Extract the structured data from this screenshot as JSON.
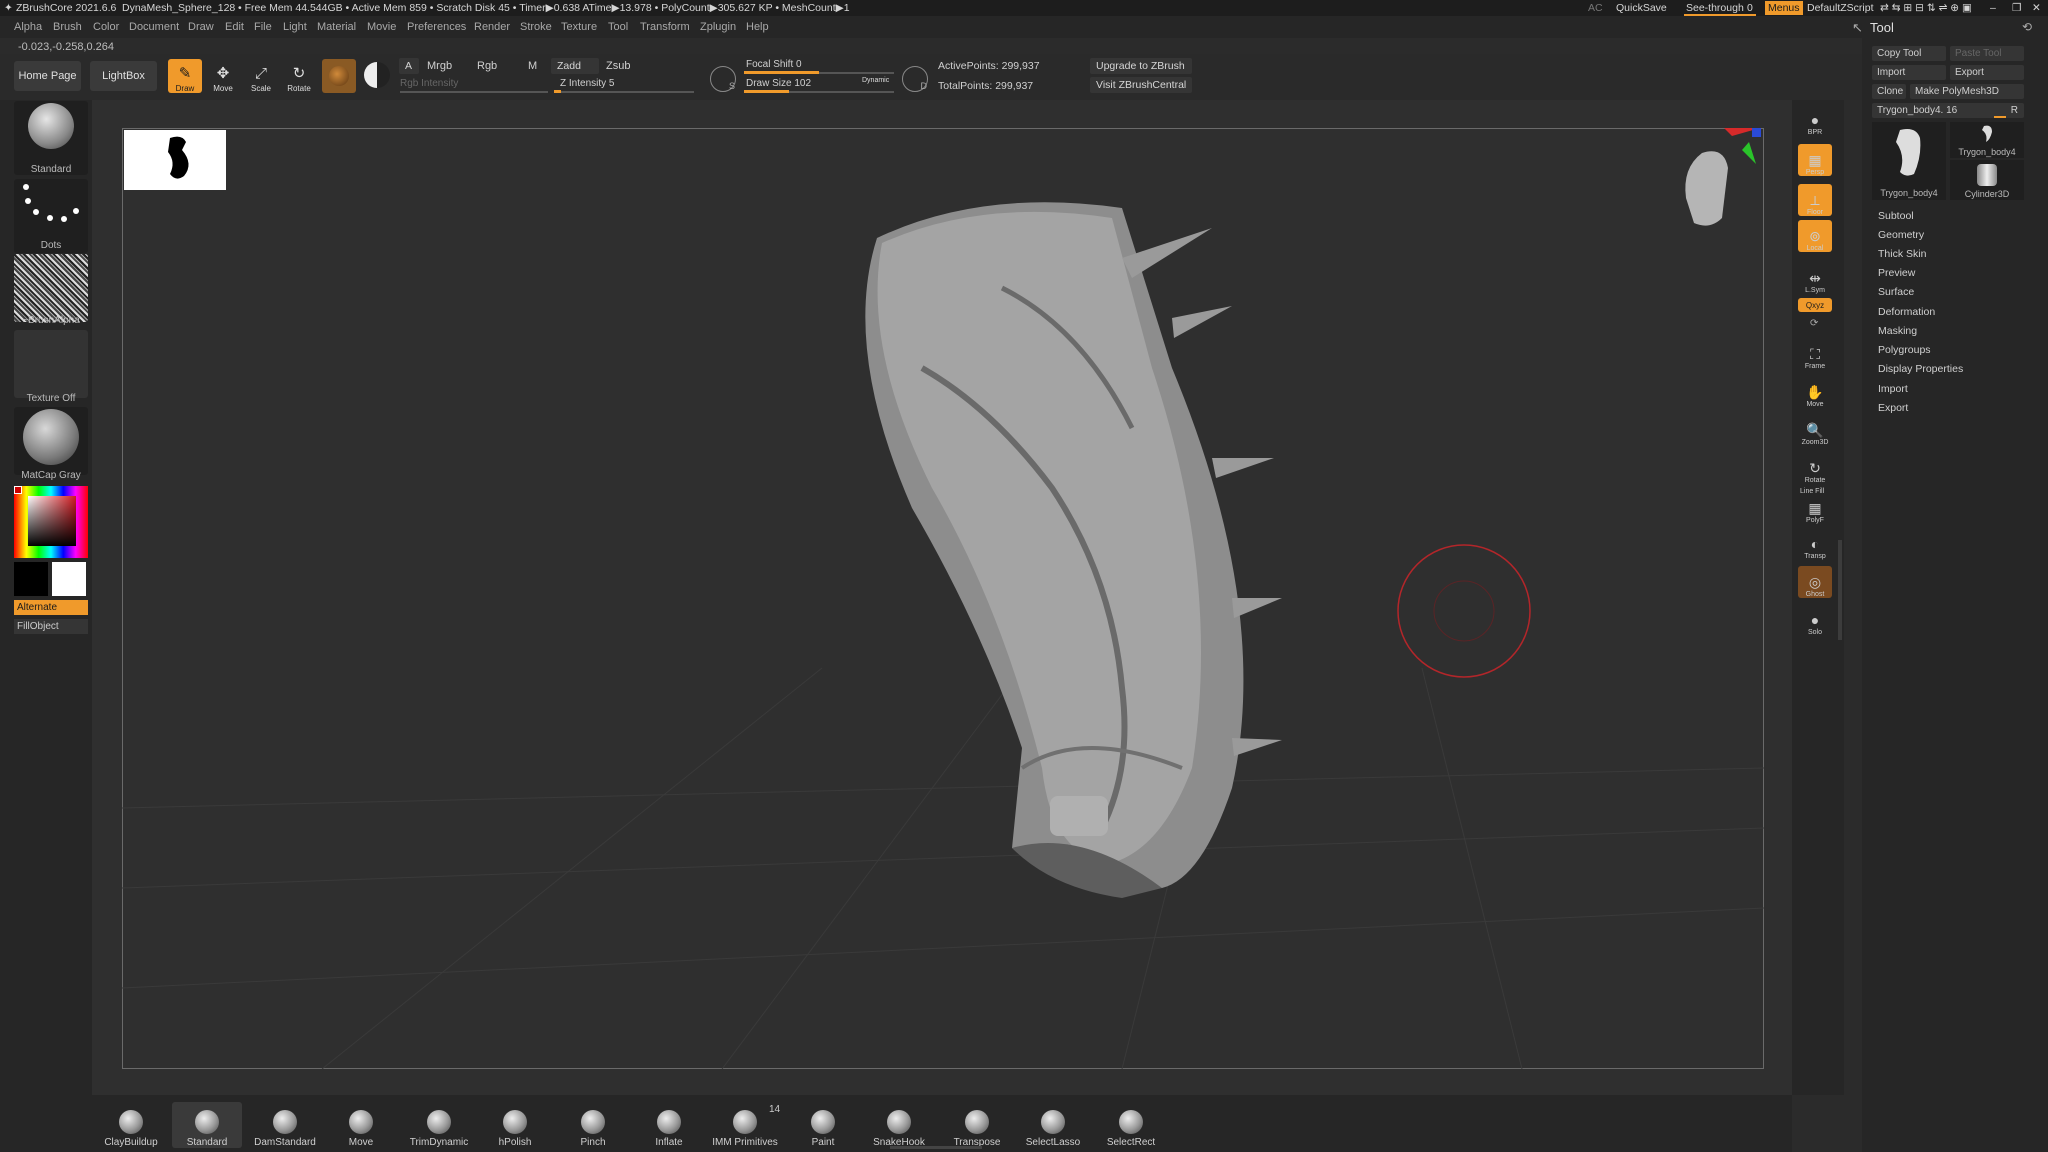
{
  "titlebar": {
    "app": "ZBrushCore 2021.6.6",
    "document": "DynaMesh_Sphere_128",
    "stats": "• Free Mem 44.544GB • Active Mem 859 • Scratch Disk 45 • Timer▶0.638 ATime▶13.978 • PolyCount▶305.627 KP • MeshCount▶1",
    "ac": "AC",
    "quicksave": "QuickSave",
    "see_through": "See-through",
    "see_through_value": "0",
    "menus": "Menus",
    "script": "DefaultZScript"
  },
  "menubar": [
    "Alpha",
    "Brush",
    "Color",
    "Document",
    "Draw",
    "Edit",
    "File",
    "Light",
    "Material",
    "Movie",
    "Preferences",
    "Render",
    "Stroke",
    "Texture",
    "Tool",
    "Transform",
    "Zplugin",
    "Help"
  ],
  "coords": "-0.023,-0.258,0.264",
  "topshelf": {
    "home": "Home Page",
    "lightbox": "LightBox",
    "draw": "Draw",
    "move": "Move",
    "scale": "Scale",
    "rotate": "Rotate",
    "a": "A",
    "mrgb": "Mrgb",
    "rgb": "Rgb",
    "m": "M",
    "zadd": "Zadd",
    "zsub": "Zsub",
    "rgb_intensity": "Rgb Intensity",
    "z_intensity": "Z Intensity 5",
    "z_intensity_level": 0.05,
    "focal_shift": "Focal Shift 0",
    "focal_shift_level": 0.5,
    "draw_size": "Draw Size 102",
    "draw_size_level": 0.3,
    "dynamic": "Dynamic",
    "s": "S",
    "d": "D",
    "active_points": "ActivePoints: 299,937",
    "total_points": "TotalPoints: 299,937",
    "upgrade": "Upgrade to ZBrush",
    "visit": "Visit ZBrushCentral"
  },
  "lefttray": {
    "brush": "Standard",
    "stroke": "Dots",
    "alpha": "~BrushAlpha",
    "texture": "Texture Off",
    "material": "MatCap Gray",
    "alternate": "Alternate",
    "fillobject": "FillObject"
  },
  "rightshelf": {
    "bpr": "BPR",
    "persp": "Persp",
    "floor": "Floor",
    "local": "Local",
    "lsym": "L.Sym",
    "xyz": "Qxyz",
    "frame": "Frame",
    "move": "Move",
    "zoom3d": "Zoom3D",
    "rotate": "Rotate",
    "linefill": "Line Fill",
    "polyf": "PolyF",
    "transp": "Transp",
    "ghost": "Ghost",
    "solo": "Solo"
  },
  "rightpanel": {
    "title": "Tool",
    "copy": "Copy Tool",
    "paste": "Paste Tool",
    "import": "Import",
    "export": "Export",
    "clone": "Clone",
    "make_poly": "Make PolyMesh3D",
    "tool_slider": "Trygon_body4. 16",
    "tool_slider_value": "R",
    "thumb1": "Trygon_body4",
    "thumb2": "Trygon_body4",
    "thumb3": "Cylinder3D",
    "sections": [
      "Subtool",
      "Geometry",
      "Thick Skin",
      "Preview",
      "Surface",
      "Deformation",
      "Masking",
      "Polygroups",
      "Display Properties",
      "Import",
      "Export"
    ]
  },
  "bottomtray": {
    "brushes": [
      "ClayBuildup",
      "Standard",
      "DamStandard",
      "Move",
      "TrimDynamic",
      "hPolish",
      "Pinch",
      "Inflate",
      "IMM Primitives",
      "Paint",
      "SnakeHook",
      "Transpose",
      "SelectLasso",
      "SelectRect"
    ],
    "imm_count": "14"
  },
  "colors": {
    "accent": "#f09a2b",
    "panel": "#262626",
    "canvas": "#2f2f2f"
  }
}
